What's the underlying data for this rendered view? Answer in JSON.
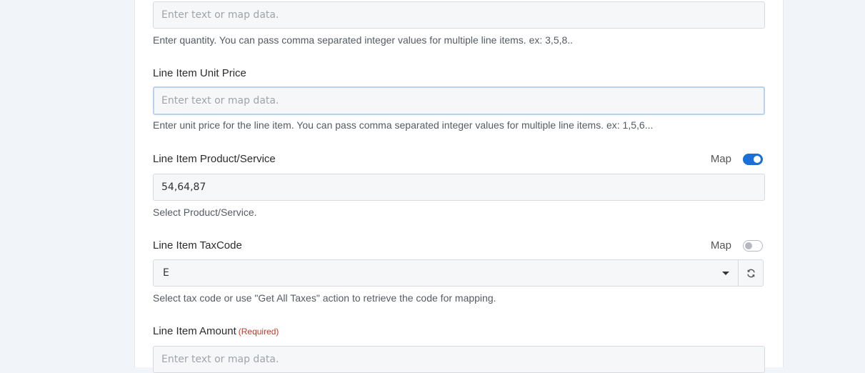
{
  "fields": {
    "quantity": {
      "placeholder": "Enter text or map data.",
      "help": "Enter quantity. You can pass comma separated integer values for multiple line items. ex: 3,5,8.."
    },
    "unit_price": {
      "label": "Line Item Unit Price",
      "placeholder": "Enter text or map data.",
      "help": "Enter unit price for the line item. You can pass comma separated integer values for multiple line items. ex: 1,5,6..."
    },
    "product_service": {
      "label": "Line Item Product/Service",
      "map_label": "Map",
      "map_enabled": true,
      "value": "54,64,87",
      "help": "Select Product/Service."
    },
    "tax_code": {
      "label": "Line Item TaxCode",
      "map_label": "Map",
      "map_enabled": false,
      "selected": "E",
      "help": "Select tax code or use \"Get All Taxes\" action to retrieve the code for mapping."
    },
    "amount": {
      "label": "Line Item Amount",
      "required_text": "(Required)",
      "placeholder": "Enter text or map data."
    }
  },
  "icons": {
    "refresh": "refresh-icon",
    "dropdown": "chevron-down-icon"
  },
  "colors": {
    "toggle_on": "#1a6fd8",
    "required": "#c0392b",
    "focus_border": "#b8d3f2",
    "background": "#f1f4f8"
  }
}
